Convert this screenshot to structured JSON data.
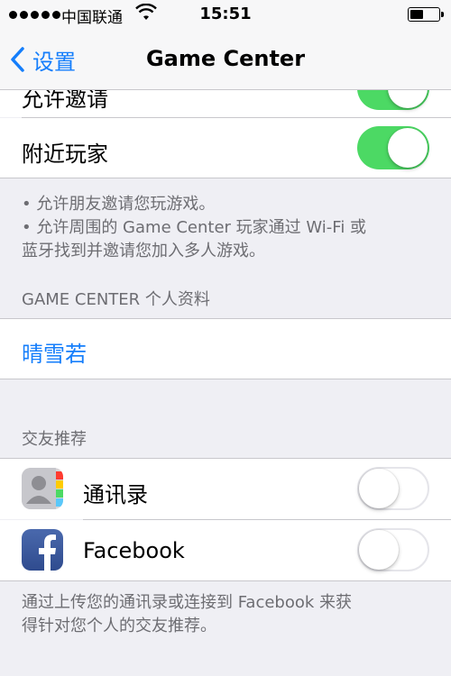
{
  "status_bar": {
    "carrier": "中国联通",
    "time": "15:51"
  },
  "nav": {
    "back_label": "设置",
    "title": "Game Center"
  },
  "settings": {
    "allow_invites_label": "允许邀请",
    "nearby_players_label": "附近玩家",
    "nearby_players_on": true,
    "allow_invites_on": true,
    "footer_line1": "• 允许朋友邀请您玩游戏。",
    "footer_line2": "• 允许周围的 Game Center 玩家通过 Wi-Fi 或",
    "footer_line3": "蓝牙找到并邀请您加入多人游戏。"
  },
  "profile": {
    "header": "GAME CENTER 个人资料",
    "name": "晴雪若"
  },
  "friend_recommendations": {
    "header": "交友推荐",
    "items": [
      {
        "label": "通讯录",
        "icon": "contacts-icon",
        "on": false
      },
      {
        "label": "Facebook",
        "icon": "facebook-icon",
        "on": false
      }
    ],
    "footer_line1": "通过上传您的通讯录或连接到 Facebook 来获",
    "footer_line2": "得针对您个人的交友推荐。"
  },
  "colors": {
    "accent": "#157efb",
    "switch_on": "#4cd964",
    "background": "#efeff4",
    "footer_text": "#6d6d72"
  }
}
